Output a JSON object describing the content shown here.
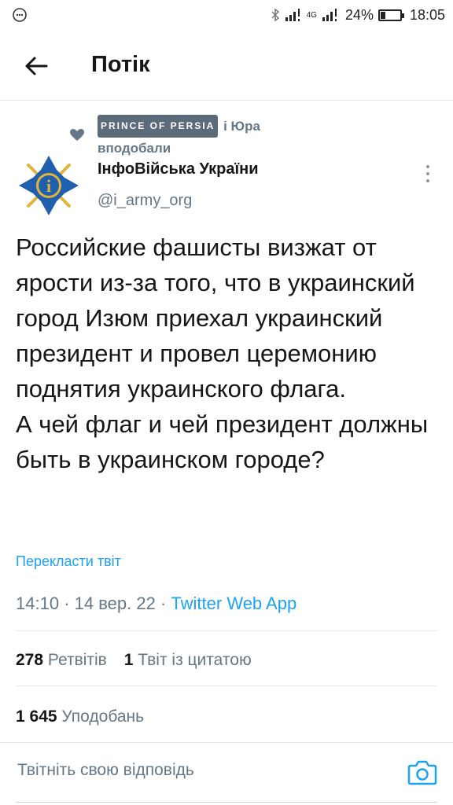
{
  "status_bar": {
    "network": "4G",
    "battery_percent_label": "24%",
    "battery_level": 0.24,
    "time": "18:05"
  },
  "header": {
    "title": "Потік",
    "back_icon": "arrow-left-icon"
  },
  "liked_by": {
    "icon": "heart-icon",
    "user1": "PRINCE OF PERSIA",
    "connector": "і Юра",
    "suffix": "вподобали"
  },
  "author": {
    "name": "ІнфоВійська України",
    "handle": "@i_army_org",
    "avatar_icon": "cross-emblem-icon",
    "more_icon": "more-vertical-icon"
  },
  "tweet": {
    "text": "Российские фашисты визжат от ярости из-за того, что в украинский город Изюм приехал украинский президент и провел церемонию поднятия украинского флага.\nА чей флаг и чей президент должны быть в украинском городе?",
    "translate_label": "Перекласти твіт",
    "time": "14:10",
    "date": "14 вер. 22",
    "separator": "·",
    "source": "Twitter Web App"
  },
  "stats": {
    "retweets_count": "278",
    "retweets_label": "Ретвітів",
    "quotes_count": "1",
    "quotes_label": "Твіт із цитатою",
    "likes_count": "1 645",
    "likes_label": "Уподобань"
  },
  "reply": {
    "placeholder": "Твітніть свою відповідь",
    "camera_icon": "camera-icon"
  },
  "colors": {
    "accent": "#1da1f2",
    "secondary_text": "#657786",
    "divider": "#e6ecf0",
    "avatar_blue": "#1f5fae",
    "avatar_gold": "#e2b43a"
  }
}
